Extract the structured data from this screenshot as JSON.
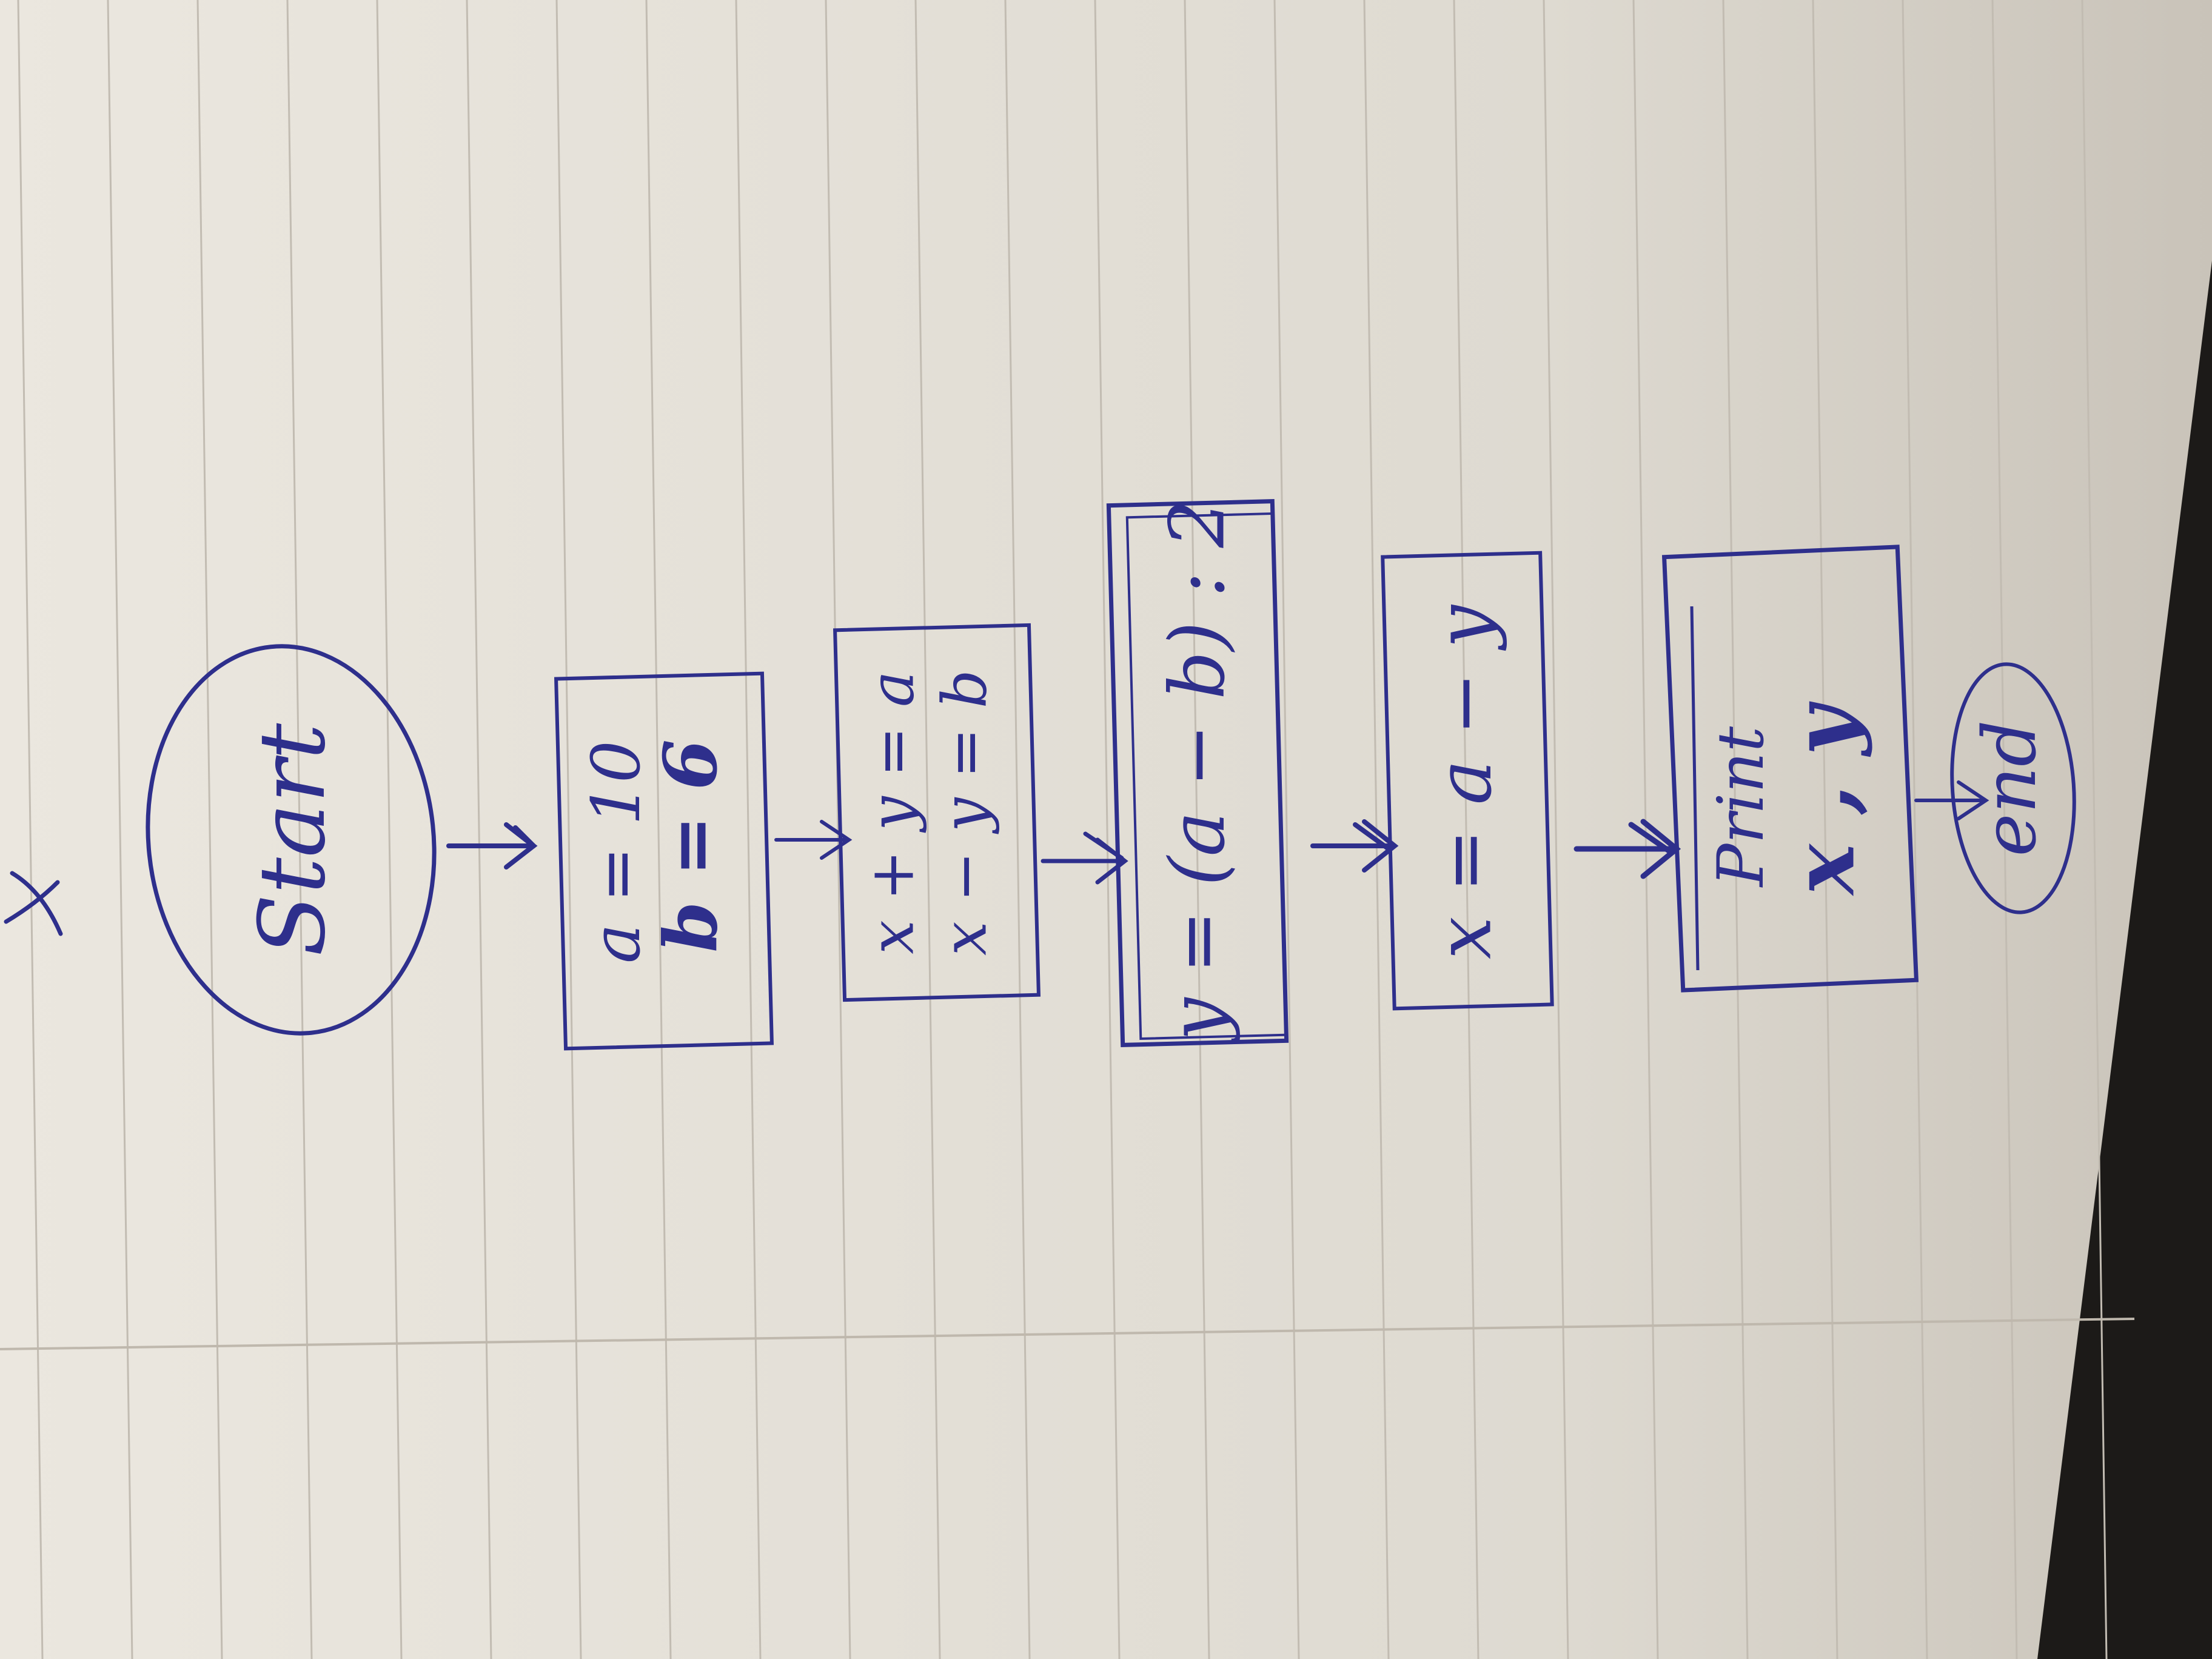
{
  "colors": {
    "paper": "#e6e2da",
    "paper_shade": "#cfcac1",
    "rule_line": "#c2bcb2",
    "margin_line": "#bfb8ad",
    "ink": "#2e2f8c",
    "desk": "#1c1a18"
  },
  "flowchart": {
    "start_label": "Start",
    "assign_box": {
      "line1": "a = 10",
      "line2": "b = 6"
    },
    "system_box": {
      "line1": "x + y = a",
      "line2": "x − y = b"
    },
    "y_box": {
      "line1": "y = (a − b) : 2"
    },
    "x_box": {
      "line1": "x = a − y"
    },
    "print_box": {
      "line1": "Print",
      "line2": "x , y"
    },
    "end_label": "end"
  }
}
